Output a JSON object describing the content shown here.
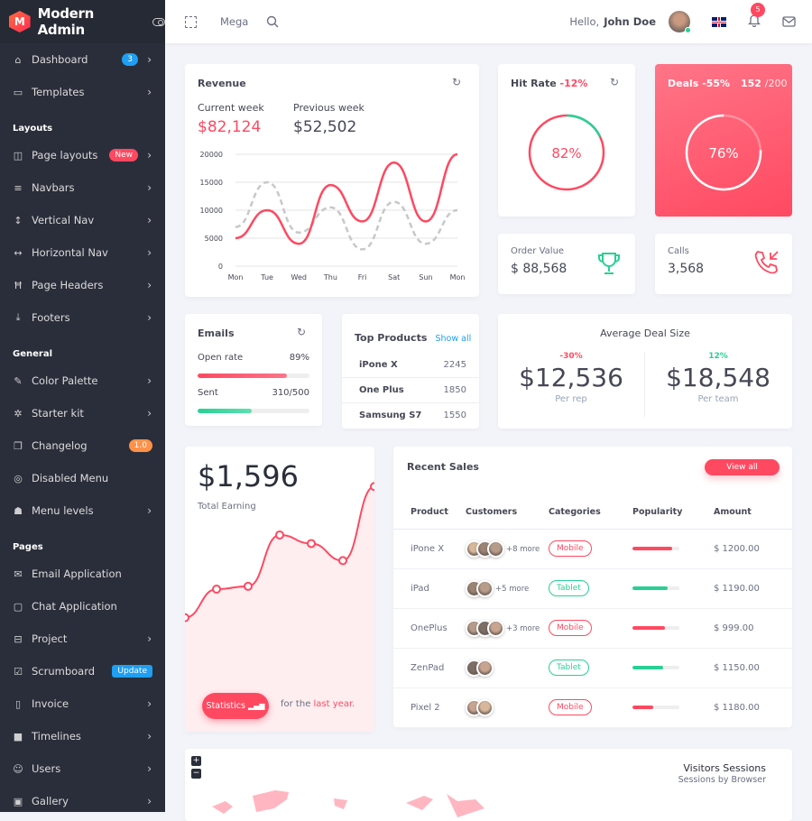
{
  "brand": {
    "name": "Modern Admin",
    "logo_letter": "M"
  },
  "topbar": {
    "mega": "Mega",
    "greeting": "Hello,",
    "user": "John Doe",
    "notifications": "5"
  },
  "sidebar": {
    "items": [
      {
        "label": "Dashboard",
        "icon": "home-icon",
        "badge": "3",
        "chevron": true
      },
      {
        "label": "Templates",
        "icon": "monitor-icon",
        "chevron": true
      }
    ],
    "sections": [
      {
        "title": "Layouts",
        "items": [
          {
            "label": "Page layouts",
            "icon": "columns-icon",
            "badge": "New",
            "chevron": true
          },
          {
            "label": "Navbars",
            "icon": "menu-icon",
            "chevron": true
          },
          {
            "label": "Vertical Nav",
            "icon": "vertical-arrows-icon",
            "chevron": true
          },
          {
            "label": "Horizontal Nav",
            "icon": "horizontal-arrows-icon",
            "chevron": true
          },
          {
            "label": "Page Headers",
            "icon": "header-icon",
            "chevron": true
          },
          {
            "label": "Footers",
            "icon": "download-icon",
            "chevron": true
          }
        ]
      },
      {
        "title": "General",
        "items": [
          {
            "label": "Color Palette",
            "icon": "pencil-icon",
            "chevron": true
          },
          {
            "label": "Starter kit",
            "icon": "puzzle-icon",
            "chevron": true
          },
          {
            "label": "Changelog",
            "icon": "copy-icon",
            "badge": "1.0"
          },
          {
            "label": "Disabled Menu",
            "icon": "eye-off-icon"
          },
          {
            "label": "Menu levels",
            "icon": "android-icon",
            "chevron": true
          }
        ]
      },
      {
        "title": "Pages",
        "items": [
          {
            "label": "Email Application",
            "icon": "mail-icon"
          },
          {
            "label": "Chat Application",
            "icon": "chat-icon"
          },
          {
            "label": "Project",
            "icon": "briefcase-icon",
            "chevron": true
          },
          {
            "label": "Scrumboard",
            "icon": "check-square-icon",
            "badge": "Update"
          },
          {
            "label": "Invoice",
            "icon": "clipboard-icon",
            "chevron": true
          },
          {
            "label": "Timelines",
            "icon": "square-icon",
            "chevron": true
          },
          {
            "label": "Users",
            "icon": "user-icon",
            "chevron": true
          },
          {
            "label": "Gallery",
            "icon": "image-icon",
            "chevron": true
          }
        ]
      }
    ]
  },
  "revenue": {
    "title": "Revenue",
    "current_label": "Current week",
    "current_value": "$82,124",
    "previous_label": "Previous week",
    "previous_value": "$52,502"
  },
  "chart_data": [
    {
      "type": "line",
      "title": "Revenue",
      "categories": [
        "Mon",
        "Tue",
        "Wed",
        "Thu",
        "Fri",
        "Sat",
        "Sun",
        "Mon"
      ],
      "ylim": [
        0,
        20000
      ],
      "yticks": [
        0,
        5000,
        10000,
        15000,
        20000
      ],
      "series": [
        {
          "name": "Current week",
          "values": [
            5000,
            10000,
            4000,
            14500,
            8000,
            18500,
            8000,
            20000
          ],
          "color": "#ff4961"
        },
        {
          "name": "Previous week",
          "values": [
            7000,
            15000,
            6000,
            10500,
            3000,
            11500,
            4000,
            10000
          ],
          "color": "#c8c8c8",
          "dashed": true
        }
      ]
    },
    {
      "type": "area",
      "title": "Total Earning",
      "series": [
        {
          "name": "Earning",
          "values": [
            40,
            50,
            51,
            69,
            66,
            60,
            86
          ]
        }
      ],
      "ylim": [
        0,
        100
      ]
    }
  ],
  "hit_rate": {
    "title": "Hit Rate",
    "change": "-12%",
    "value": "82%",
    "percent": 82
  },
  "deals": {
    "title": "Deals",
    "change": "-55%",
    "count": "152",
    "total": "/200",
    "value": "76%",
    "percent": 76
  },
  "order_value": {
    "label": "Order Value",
    "value": "$ 88,568"
  },
  "calls": {
    "label": "Calls",
    "value": "3,568"
  },
  "emails": {
    "title": "Emails",
    "open_label": "Open rate",
    "open_value": "89%",
    "open_percent": 80,
    "sent_label": "Sent",
    "sent_value": "310/500",
    "sent_percent": 48
  },
  "top_products": {
    "title": "Top Products",
    "show_all": "Show all",
    "items": [
      {
        "name": "iPone X",
        "value": "2245"
      },
      {
        "name": "One Plus",
        "value": "1850"
      },
      {
        "name": "Samsung S7",
        "value": "1550"
      }
    ]
  },
  "avg_deal": {
    "title": "Average Deal Size",
    "rep_change": "-30%",
    "rep_value": "$12,536",
    "rep_label": "Per rep",
    "team_change": "12%",
    "team_value": "$18,548",
    "team_label": "Per team"
  },
  "earning": {
    "value": "$1,596",
    "label": "Total Earning",
    "button": "Statistics",
    "for": "for the",
    "period": "last year."
  },
  "recent_sales": {
    "title": "Recent Sales",
    "view_all": "View all",
    "columns": [
      "Product",
      "Customers",
      "Categories",
      "Popularity",
      "Amount"
    ],
    "rows": [
      {
        "product": "iPone X",
        "avatars": 3,
        "more": "+8 more",
        "category": "Mobile",
        "popularity": 85,
        "amount": "$ 1200.00"
      },
      {
        "product": "iPad",
        "avatars": 2,
        "more": "+5 more",
        "category": "Tablet",
        "popularity": 75,
        "amount": "$ 1190.00"
      },
      {
        "product": "OnePlus",
        "avatars": 3,
        "more": "+3 more",
        "category": "Mobile",
        "popularity": 70,
        "amount": "$ 999.00"
      },
      {
        "product": "ZenPad",
        "avatars": 2,
        "more": "",
        "category": "Tablet",
        "popularity": 65,
        "amount": "$ 1150.00"
      },
      {
        "product": "Pixel 2",
        "avatars": 2,
        "more": "",
        "category": "Mobile",
        "popularity": 45,
        "amount": "$ 1180.00"
      }
    ]
  },
  "visitors": {
    "title": "Visitors Sessions",
    "subtitle": "Sessions by Browser",
    "zoom_in": "+",
    "zoom_out": "−"
  }
}
